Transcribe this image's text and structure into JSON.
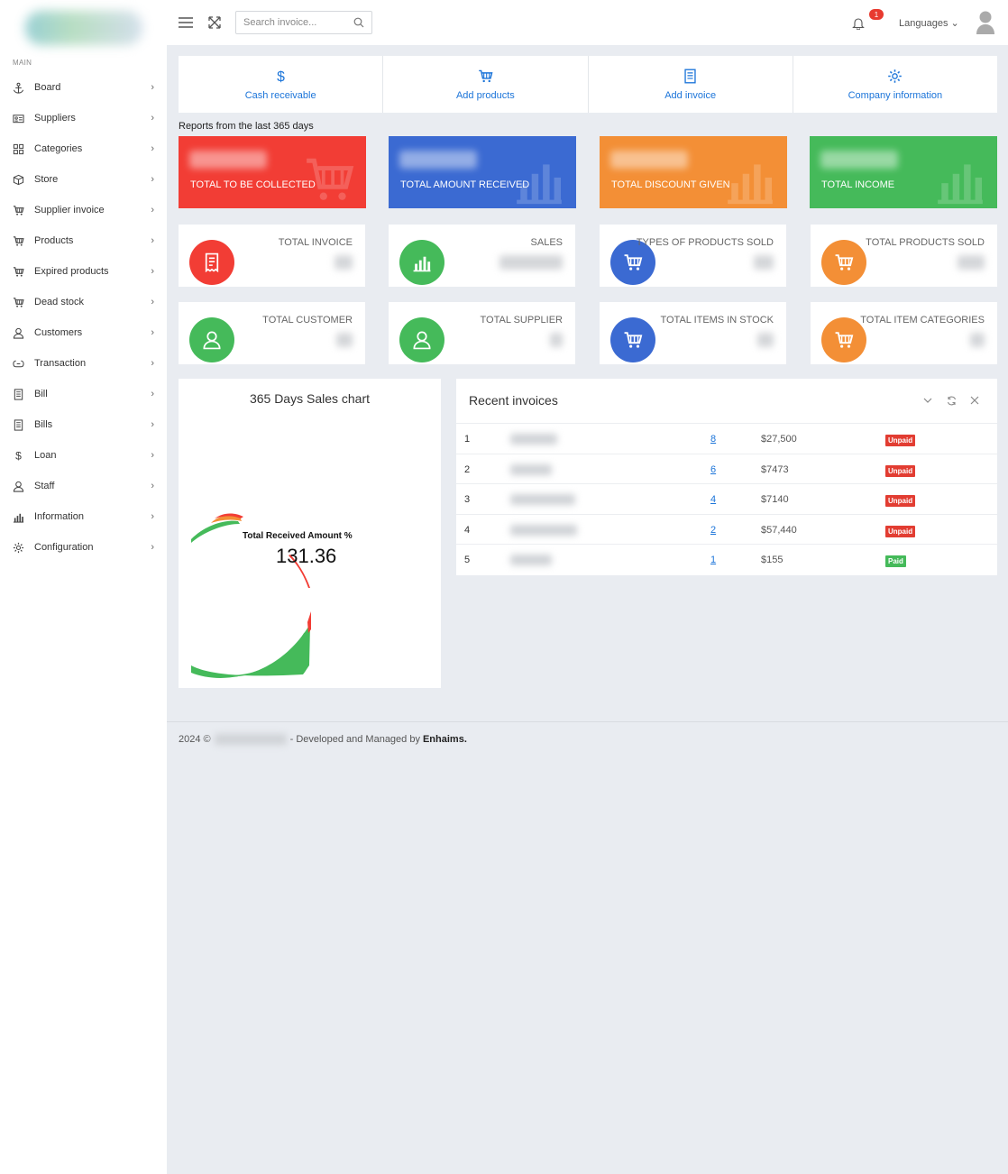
{
  "sidebar": {
    "caption": "MAIN",
    "items": [
      {
        "label": "Board",
        "icon": "anchor-icon"
      },
      {
        "label": "Suppliers",
        "icon": "id-card-icon"
      },
      {
        "label": "Categories",
        "icon": "grid-icon"
      },
      {
        "label": "Store",
        "icon": "box-icon"
      },
      {
        "label": "Supplier invoice",
        "icon": "cart-icon"
      },
      {
        "label": "Products",
        "icon": "cart-icon"
      },
      {
        "label": "Expired products",
        "icon": "cart-icon"
      },
      {
        "label": "Dead stock",
        "icon": "cart-icon"
      },
      {
        "label": "Customers",
        "icon": "user-icon"
      },
      {
        "label": "Transaction",
        "icon": "transfer-icon"
      },
      {
        "label": "Bill",
        "icon": "document-icon"
      },
      {
        "label": "Bills",
        "icon": "document-icon"
      },
      {
        "label": "Loan",
        "icon": "dollar-icon"
      },
      {
        "label": "Staff",
        "icon": "user-icon"
      },
      {
        "label": "Information",
        "icon": "bar-chart-icon"
      },
      {
        "label": "Configuration",
        "icon": "gear-icon"
      }
    ]
  },
  "topbar": {
    "search_placeholder": "Search invoice...",
    "notification_count": "1",
    "languages_label": "Languages"
  },
  "quick_actions": [
    {
      "label": "Cash receivable",
      "icon": "dollar-icon"
    },
    {
      "label": "Add products",
      "icon": "cart-icon"
    },
    {
      "label": "Add invoice",
      "icon": "document-icon"
    },
    {
      "label": "Company information",
      "icon": "gear-icon"
    }
  ],
  "reports_caption": "Reports from the last 365 days",
  "color_cards": [
    {
      "label": "TOTAL TO BE COLLECTED",
      "color": "#f23d35",
      "icon": "cart-icon"
    },
    {
      "label": "TOTAL AMOUNT RECEIVED",
      "color": "#3b6ad2",
      "icon": "bar-chart-icon"
    },
    {
      "label": "TOTAL DISCOUNT GIVEN",
      "color": "#f38f36",
      "icon": "bar-chart-icon"
    },
    {
      "label": "TOTAL INCOME",
      "color": "#45ba5a",
      "icon": "bar-chart-icon"
    }
  ],
  "stat_cards_row1": [
    {
      "label": "TOTAL INVOICE",
      "color": "#f23d35",
      "icon": "receipt-icon"
    },
    {
      "label": "SALES",
      "color": "#45ba5a",
      "icon": "bar-chart-icon"
    },
    {
      "label": "TYPES OF PRODUCTS SOLD",
      "color": "#3b6ad2",
      "icon": "cart-icon"
    },
    {
      "label": "TOTAL PRODUCTS SOLD",
      "color": "#f38f36",
      "icon": "cart-icon"
    }
  ],
  "stat_cards_row2": [
    {
      "label": "TOTAL CUSTOMER",
      "color": "#45ba5a",
      "icon": "user-icon"
    },
    {
      "label": "TOTAL SUPPLIER",
      "color": "#45ba5a",
      "icon": "user-icon"
    },
    {
      "label": "TOTAL ITEMS IN STOCK",
      "color": "#3b6ad2",
      "icon": "cart-icon"
    },
    {
      "label": "TOTAL ITEM CATEGORIES",
      "color": "#f38f36",
      "icon": "cart-icon"
    }
  ],
  "sales_chart": {
    "title": "365 Days Sales chart",
    "center_label": "Total Received Amount %",
    "center_value": "131.36"
  },
  "chart_data": {
    "type": "pie",
    "title": "365 Days Sales chart",
    "center_label": "Total Received Amount %",
    "center_value": 131.36,
    "colors": [
      "#45ba5a",
      "#f23d35",
      "#f38f36"
    ]
  },
  "recent_invoices": {
    "title": "Recent invoices",
    "rows": [
      {
        "num": "1",
        "link": "8",
        "amount": "$27,500",
        "status": "Unpaid"
      },
      {
        "num": "2",
        "link": "6",
        "amount": "$7473",
        "status": "Unpaid"
      },
      {
        "num": "3",
        "link": "4",
        "amount": "$7140",
        "status": "Unpaid"
      },
      {
        "num": "4",
        "link": "2",
        "amount": "$57,440",
        "status": "Unpaid"
      },
      {
        "num": "5",
        "link": "1",
        "amount": "$155",
        "status": "Paid"
      }
    ],
    "status_colors": {
      "Unpaid": "#e23d32",
      "Paid": "#45ba5a"
    }
  },
  "footer": {
    "year": "2024 ©",
    "text": "- Developed and Managed by",
    "brand": "Enhaims."
  }
}
